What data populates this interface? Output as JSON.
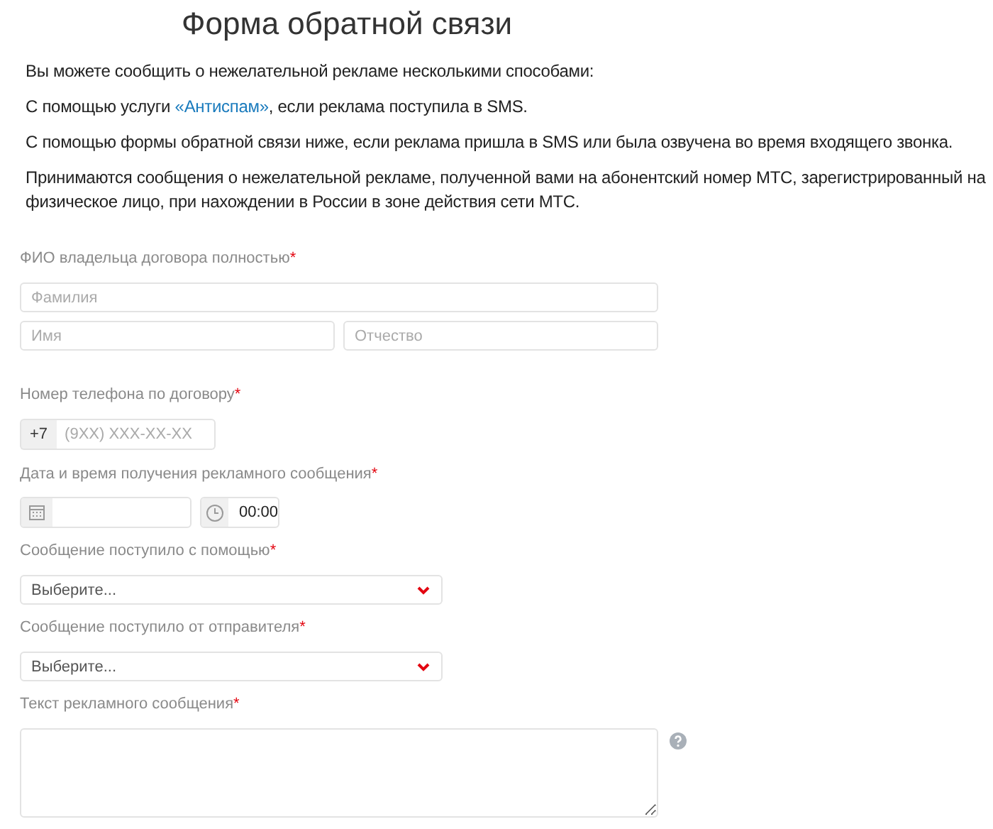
{
  "title": "Форма обратной связи",
  "paragraphs": [
    [
      {
        "kind": "text",
        "text": "Вы можете сообщить о нежелательной рекламе несколькими способами:"
      }
    ],
    [
      {
        "kind": "text",
        "text": "С помощью услуги "
      },
      {
        "kind": "link",
        "text": "«Антиспам»"
      },
      {
        "kind": "text",
        "text": ", если реклама поступила в SMS."
      }
    ],
    [
      {
        "kind": "text",
        "text": "С помощью формы обратной связи ниже, если реклама пришла в SMS или была озвучена во время входящего звонка."
      }
    ],
    [
      {
        "kind": "text",
        "text": "Принимаются сообщения о нежелательной рекламе, полученной вами на абонентский номер МТС, зарегистрированный на физическое лицо, при нахождении в России в зоне действия сети МТС."
      }
    ]
  ],
  "required_mark": "*",
  "name_section": {
    "label": "ФИО владельца договора полностью",
    "surname": {
      "placeholder": "Фамилия"
    },
    "first_name": {
      "placeholder": "Имя"
    },
    "patronymic": {
      "placeholder": "Отчество"
    }
  },
  "phone_section": {
    "label": "Номер телефона по договору",
    "prefix": "+7",
    "placeholder": "(9XX) XXX-XX-XX"
  },
  "datetime_section": {
    "label": "Дата и время получения рекламного сообщения",
    "time": "00:00"
  },
  "selects": [
    {
      "label": "Сообщение поступило с помощью",
      "value": "Выберите..."
    },
    {
      "label": "Сообщение поступило от отправителя",
      "value": "Выберите..."
    }
  ],
  "message_section": {
    "label": "Текст рекламного сообщения"
  }
}
